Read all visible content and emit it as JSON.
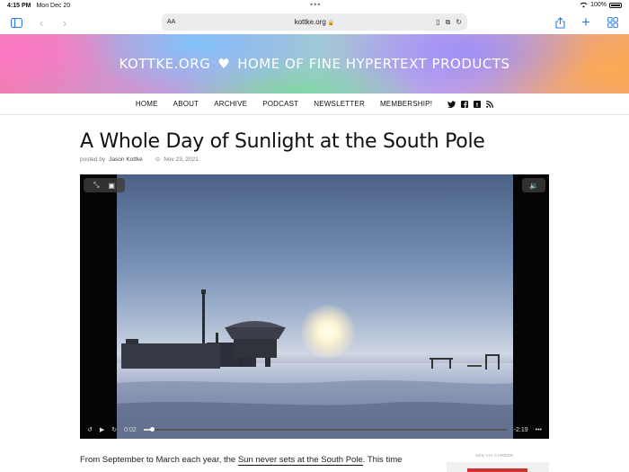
{
  "status": {
    "time": "4:15 PM",
    "date": "Mon Dec 20",
    "battery": "100%"
  },
  "toolbar": {
    "text_size": "AA",
    "url": "kottke.org"
  },
  "banner": {
    "left": "KOTTKE.ORG",
    "heart": "♥",
    "right": "HOME OF FINE HYPERTEXT PRODUCTS"
  },
  "nav": {
    "items": [
      "HOME",
      "ABOUT",
      "ARCHIVE",
      "PODCAST",
      "NEWSLETTER",
      "MEMBERSHIP!"
    ],
    "social": [
      "twitter-icon",
      "facebook-icon",
      "tumblr-icon",
      "rss-icon"
    ]
  },
  "article": {
    "title": "A Whole Day of Sunlight at the South Pole",
    "posted_by": "posted by",
    "author": "Jason Kottke",
    "date": "Nov 23, 2021",
    "body_before": "From September to March each year, the ",
    "body_link": "Sun never sets at the South Pole",
    "body_after": ". This time"
  },
  "video": {
    "elapsed": "0:02",
    "remaining": "-2:19",
    "progress": 0.024
  },
  "sidebar": {
    "ads_label": "ADS VIA CARBON"
  },
  "colors": {
    "accent": "#2f7ce8",
    "banner_text": "#ffffff"
  }
}
